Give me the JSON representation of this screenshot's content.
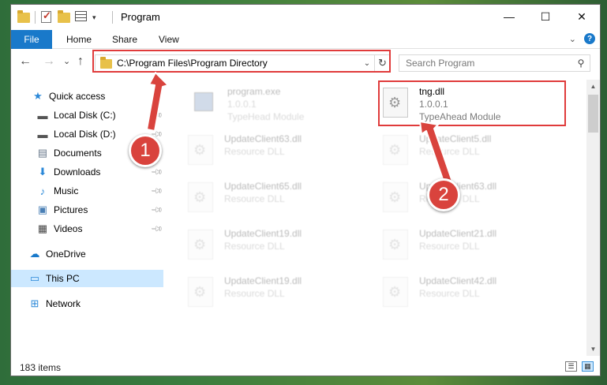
{
  "window": {
    "title": "Program",
    "controls": {
      "minimize": "—",
      "maximize": "☐",
      "close": "✕"
    }
  },
  "ribbon": {
    "tabs": [
      "File",
      "Home",
      "Share",
      "View"
    ]
  },
  "nav": {
    "back": "←",
    "forward": "→",
    "recent": "⌄",
    "up": "↑",
    "address": "C:\\Program Files\\Program Directory",
    "search_placeholder": "Search Program"
  },
  "sidebar": {
    "items": [
      {
        "label": "Quick access",
        "icon": "star-icon",
        "pinned": false
      },
      {
        "label": "Local Disk (C:)",
        "icon": "drive-icon",
        "pinned": true
      },
      {
        "label": "Local Disk (D:)",
        "icon": "drive-icon",
        "pinned": true
      },
      {
        "label": "Documents",
        "icon": "documents-icon",
        "pinned": true
      },
      {
        "label": "Downloads",
        "icon": "download-icon",
        "pinned": true
      },
      {
        "label": "Music",
        "icon": "music-icon",
        "pinned": true
      },
      {
        "label": "Pictures",
        "icon": "pictures-icon",
        "pinned": true
      },
      {
        "label": "Videos",
        "icon": "videos-icon",
        "pinned": true
      },
      {
        "label": "OneDrive",
        "icon": "cloud-icon",
        "pinned": false
      },
      {
        "label": "This PC",
        "icon": "pc-icon",
        "pinned": false,
        "selected": true
      },
      {
        "label": "Network",
        "icon": "network-icon",
        "pinned": false
      }
    ]
  },
  "files": [
    {
      "name": "program.exe",
      "line2": "1.0.0.1",
      "line3": "TypeHead Module",
      "faded": true
    },
    {
      "name": "tng.dll",
      "line2": "1.0.0.1",
      "line3": "TypeAhead Module",
      "faded": false
    },
    {
      "name": "UpdateClient63.dll",
      "line2": "Resource DLL",
      "faded": true
    },
    {
      "name": "UpdateClient5.dll",
      "line2": "Resource DLL",
      "faded": true
    },
    {
      "name": "UpdateClient65.dll",
      "line2": "Resource DLL",
      "faded": true
    },
    {
      "name": "UpdateClient63.dll",
      "line2": "Resource DLL",
      "faded": true
    },
    {
      "name": "UpdateClient19.dll",
      "line2": "Resource DLL",
      "faded": true
    },
    {
      "name": "UpdateClient21.dll",
      "line2": "Resource DLL",
      "faded": true
    },
    {
      "name": "UpdateClient19.dll",
      "line2": "Resource DLL",
      "faded": true
    },
    {
      "name": "UpdateClient42.dll",
      "line2": "Resource DLL",
      "faded": true
    }
  ],
  "status": {
    "count": "183 items"
  },
  "annotations": {
    "badge1": "1",
    "badge2": "2",
    "color": "#d9433d"
  },
  "colors": {
    "accent": "#1979ca",
    "selected": "#cce8ff"
  }
}
